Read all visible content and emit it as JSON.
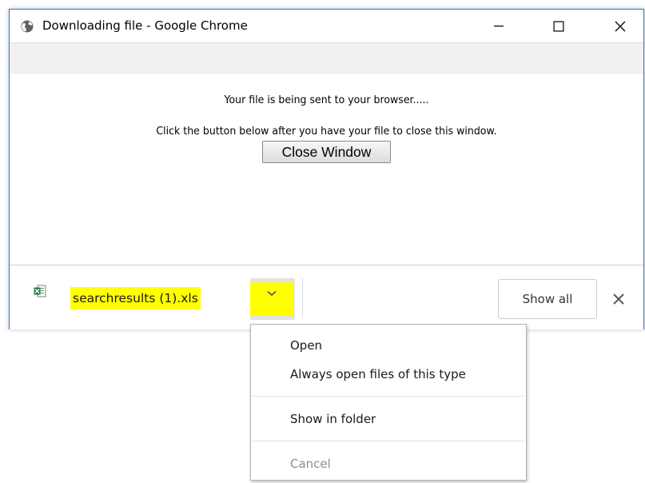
{
  "window": {
    "title": "Downloading file - Google Chrome"
  },
  "content": {
    "message_line1": "Your file is being sent to your browser.....",
    "message_line2": "Click the button below after you have your file to close this window.",
    "close_button_label": "Close Window"
  },
  "download_bar": {
    "file_name": "searchresults (1).xls",
    "file_icon": "excel-file-icon",
    "show_all_label": "Show all",
    "highlight_color": "#ffff00"
  },
  "context_menu": {
    "items": [
      {
        "label": "Open"
      },
      {
        "label": "Always open files of this type"
      },
      {
        "label": "Show in folder"
      },
      {
        "label": "Cancel",
        "disabled": true
      }
    ]
  }
}
